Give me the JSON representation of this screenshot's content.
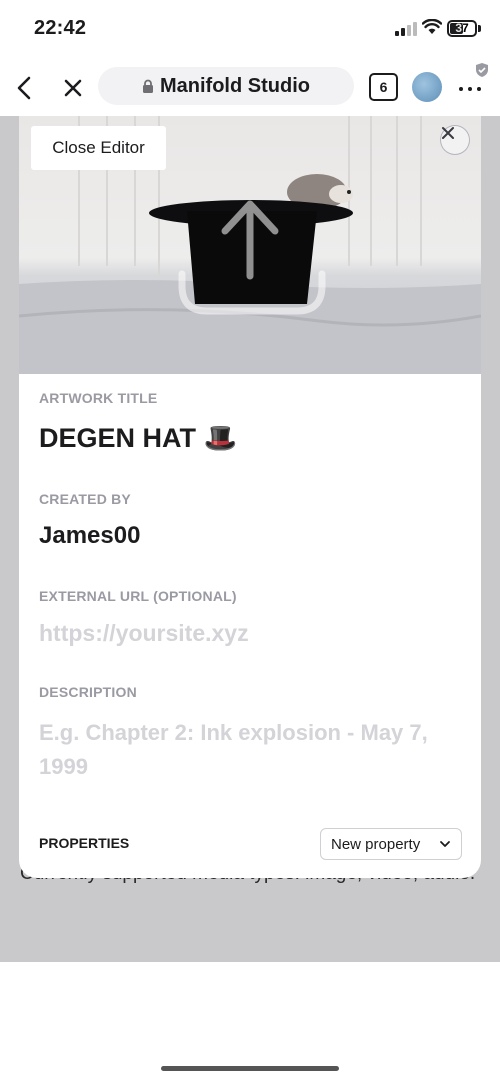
{
  "status_bar": {
    "time": "22:42",
    "battery": "37"
  },
  "browser": {
    "site_title": "Manifold Studio",
    "tab_count": "6",
    "icons": [
      "back-chevron-icon",
      "close-icon",
      "lock-icon",
      "avatar",
      "more-icon",
      "shield-icon"
    ]
  },
  "editor": {
    "close_editor_label": "Close Editor",
    "artwork_title_label": "ARTWORK TITLE",
    "artwork_title": "DEGEN HAT 🎩",
    "created_by_label": "CREATED BY",
    "created_by": "James00",
    "external_url_label": "EXTERNAL URL (OPTIONAL)",
    "external_url_placeholder": "https://yoursite.xyz",
    "description_label": "DESCRIPTION",
    "description_placeholder": "E.g. Chapter 2: Ink explosion - May 7, 1999",
    "properties_label": "PROPERTIES",
    "new_property_label": "New property"
  },
  "background_page": {
    "text": "Currently supported media types: image, video, audio."
  },
  "colors": {
    "label_gray": "#9a9aa3",
    "placeholder_gray": "#d3d3d8",
    "backdrop": "#c9c9cb",
    "text_dark": "#1c1c1e"
  }
}
